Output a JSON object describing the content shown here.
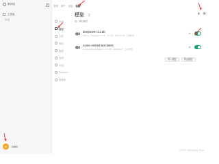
{
  "sidebar": {
    "brand_label": "新对话",
    "nav": [
      {
        "label": "工作区"
      },
      {
        "label": "对话"
      }
    ],
    "user": {
      "avatar_text": "D",
      "name": "DWC"
    }
  },
  "settings": {
    "crumbs": [
      "常规",
      "用户",
      "对话",
      "设置"
    ],
    "nav_items": [
      {
        "label": "常规",
        "active": false
      },
      {
        "label": "模型",
        "active": true
      },
      {
        "label": "文档",
        "active": false
      },
      {
        "label": "网络",
        "active": false
      },
      {
        "label": "图像",
        "active": false
      },
      {
        "label": "音频",
        "active": false
      },
      {
        "label": "对话",
        "active": false
      },
      {
        "label": "Pipelines",
        "active": false
      },
      {
        "label": "数据库",
        "active": false
      }
    ]
  },
  "models": {
    "title": "模型",
    "count": "2",
    "add_label": "添加模型",
    "items": [
      {
        "name": "deepseek-r1:1.5b",
        "description": "Ollama · deepseek-r1:1.5b · 1.1 GB · 2025-02-05 · 上次修改",
        "enabled": true
      },
      {
        "name": "nomic-embed-text:latest",
        "description": "nomic-embed-text:latest · 274 MB · 2025-02-05 · 上次修改",
        "enabled": true
      }
    ],
    "import_label": "导入模型",
    "export_label": "导出模型"
  },
  "watermark": "CSDN @Wazzy Star",
  "colors": {
    "accent_green": "#16a06f",
    "arrow_red": "#e0322c",
    "avatar": "#f4a621"
  }
}
